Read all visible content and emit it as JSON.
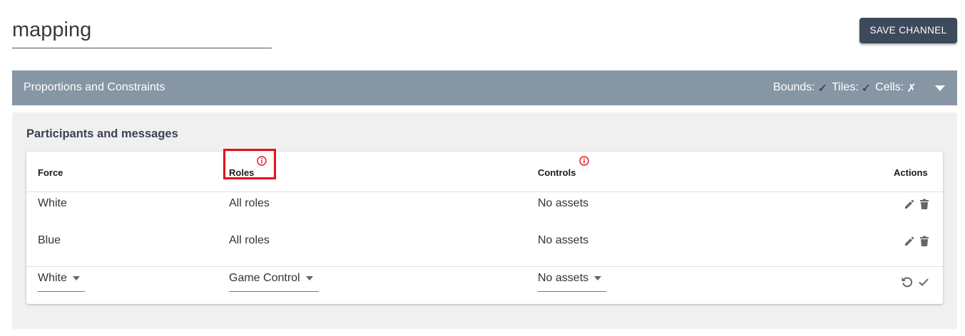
{
  "channel": {
    "name": "mapping"
  },
  "toolbar": {
    "save_label": "SAVE CHANNEL"
  },
  "accordion": {
    "title": "Proportions and Constraints",
    "status": [
      {
        "label": "Bounds:",
        "mark": "✓"
      },
      {
        "label": "Tiles:",
        "mark": "✓"
      },
      {
        "label": "Cells:",
        "mark": "✗"
      }
    ],
    "expand_icon": "chevron-down-icon"
  },
  "participants": {
    "title": "Participants and messages",
    "columns": {
      "force": "Force",
      "roles": "Roles",
      "controls": "Controls",
      "actions": "Actions"
    },
    "rows": [
      {
        "force": "White",
        "roles": "All roles",
        "controls": "No assets"
      },
      {
        "force": "Blue",
        "roles": "All roles",
        "controls": "No assets"
      }
    ],
    "new_row": {
      "force": "White",
      "roles": "Game Control",
      "controls": "No assets"
    },
    "colors": {
      "accent": "#3d4a5b",
      "header_bar": "#8796a5",
      "info": "#e0121d"
    }
  }
}
